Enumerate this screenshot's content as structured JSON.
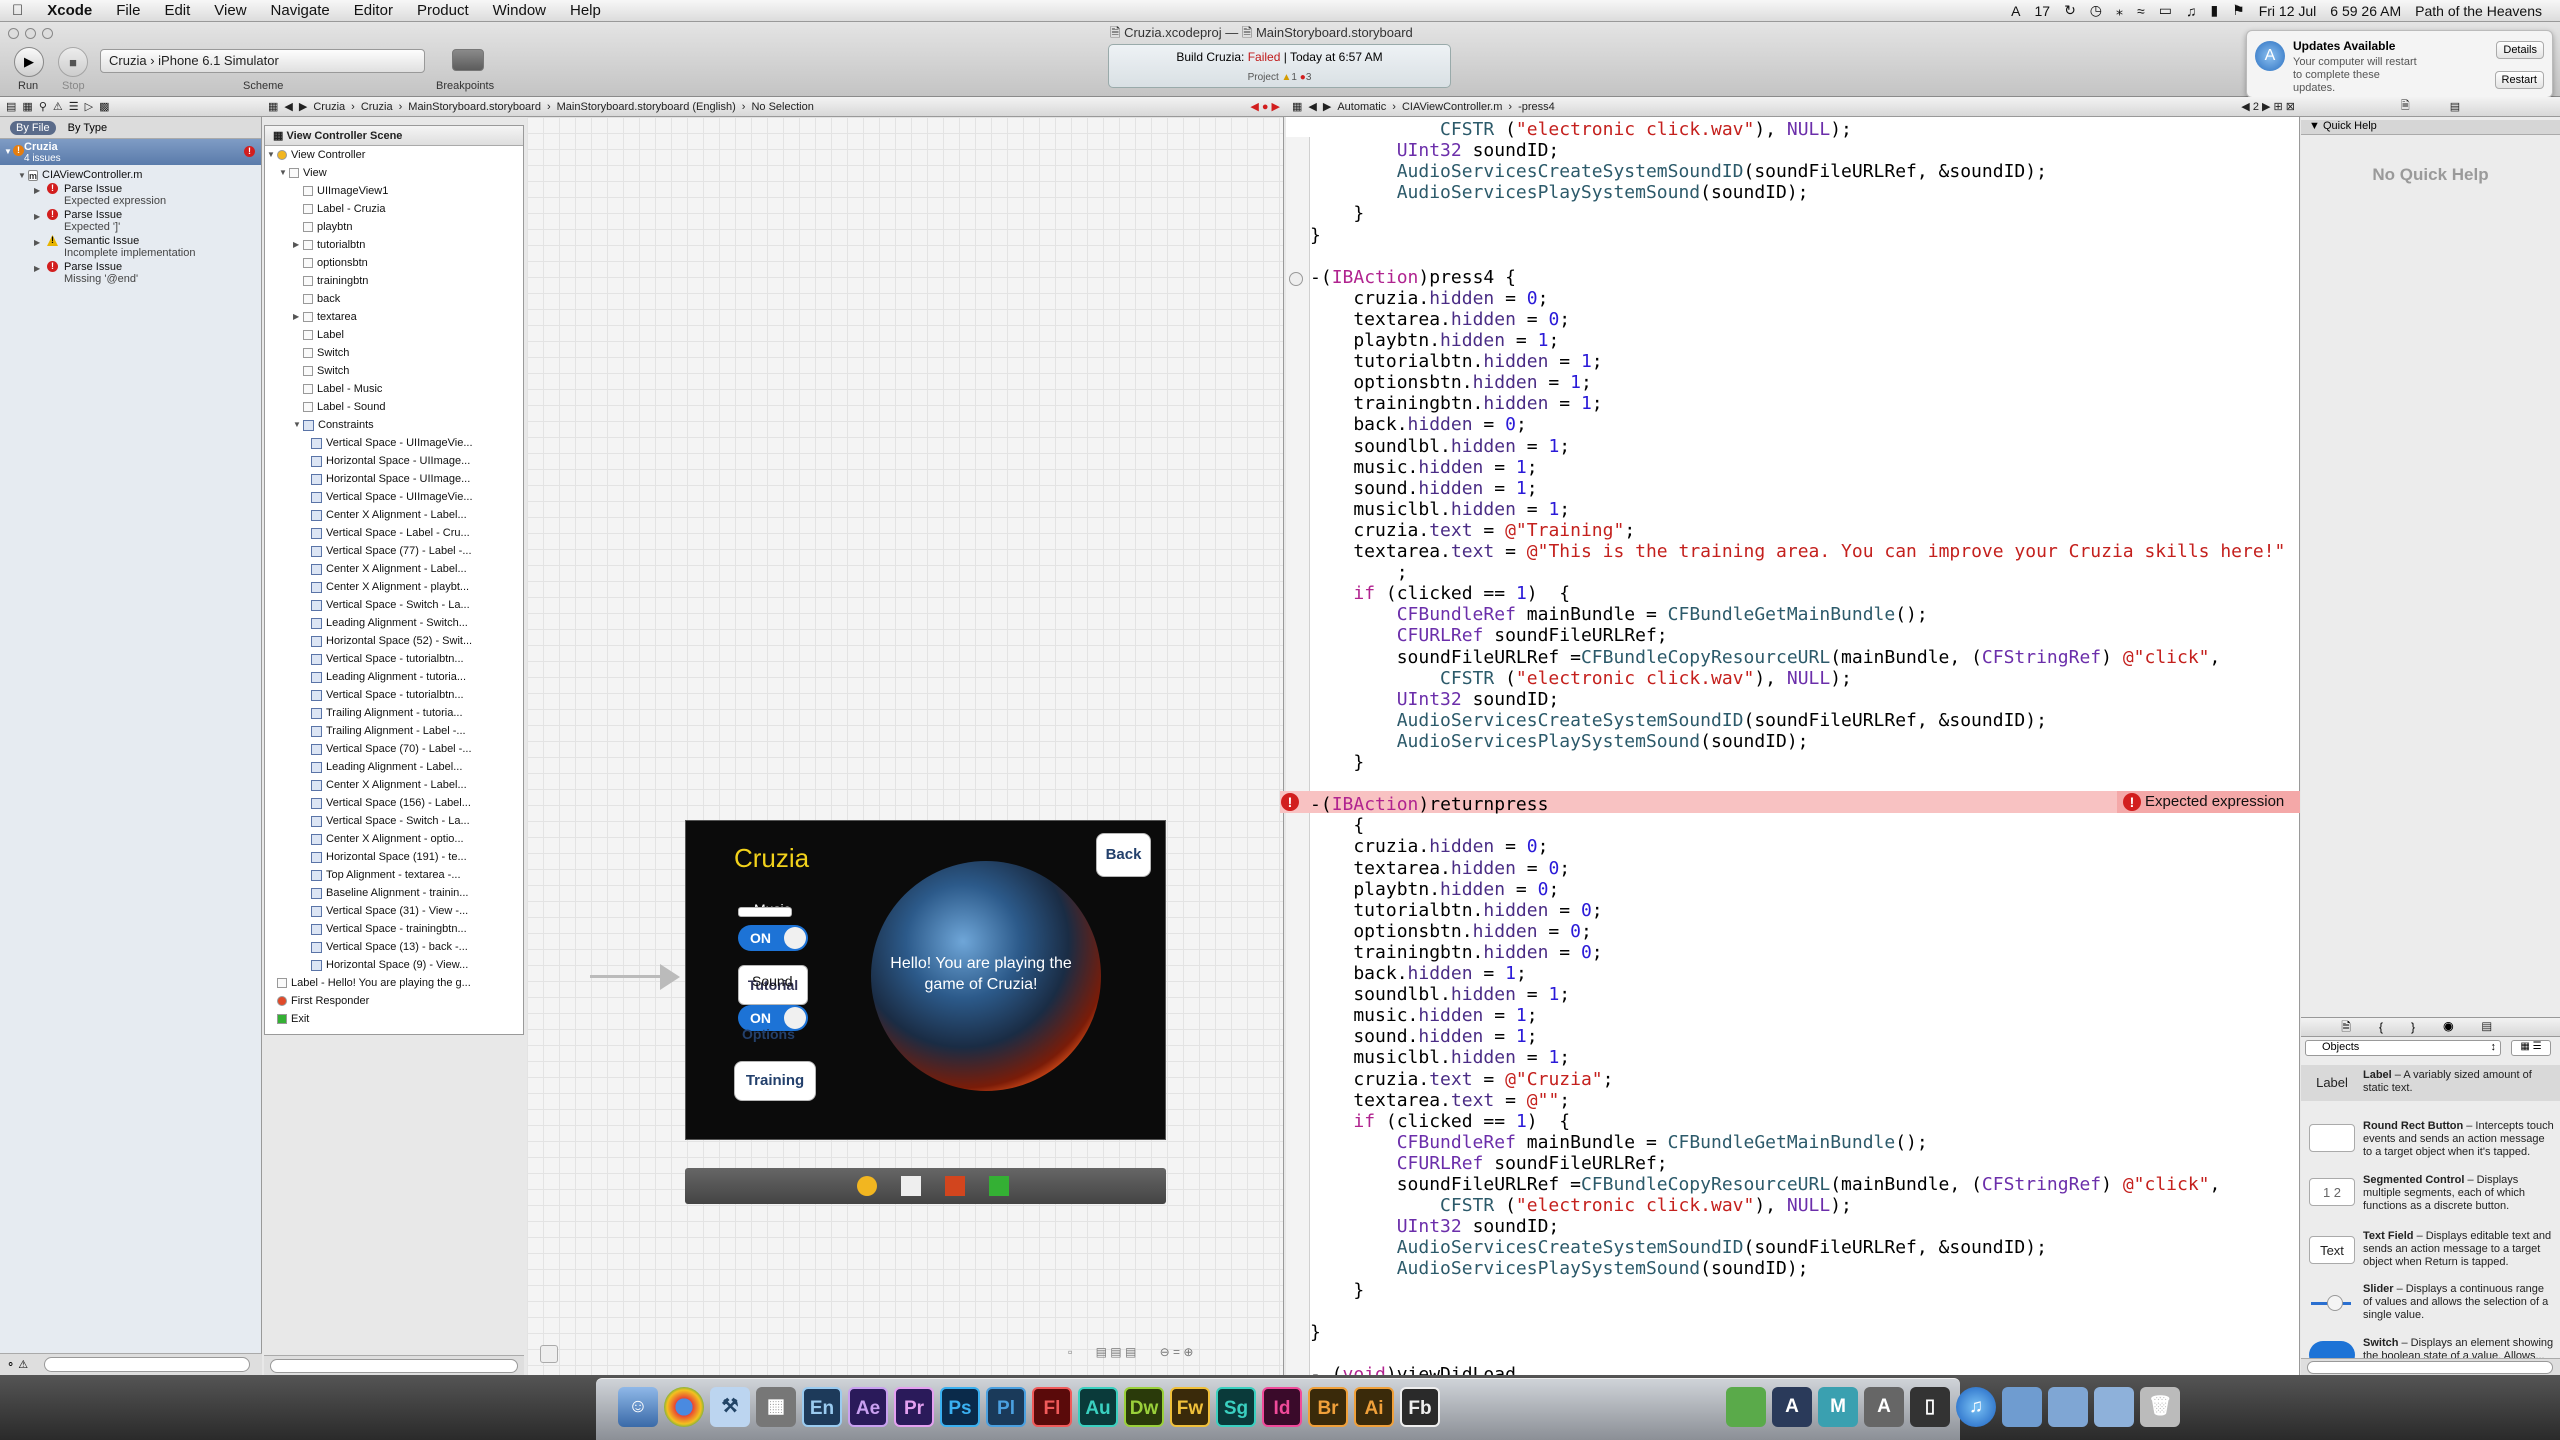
{
  "menubar": {
    "apple": "",
    "app_name": "Xcode",
    "items": [
      "File",
      "Edit",
      "View",
      "Navigate",
      "Editor",
      "Product",
      "Window",
      "Help"
    ],
    "status": [
      "17",
      "Fri 12 Jul",
      "6 59 26 AM",
      "Path of the Heavens"
    ]
  },
  "toolbar": {
    "run_label": "Run",
    "stop_label": "Stop",
    "scheme_project": "Cruzia",
    "scheme_target": "iPhone 6.1 Simulator",
    "scheme_label": "Scheme",
    "breakpoints_label": "Breakpoints",
    "title_file1": "Cruzia.xcodeproj",
    "title_sep": "—",
    "title_file2": "MainStoryboard.storyboard",
    "activity_build": "Build Cruzia:",
    "activity_status": "Failed",
    "activity_time": "Today at 6:57 AM",
    "activity_project": "Project",
    "activity_warn": "1",
    "activity_err": "3"
  },
  "notification": {
    "title": "Updates Available",
    "body": "Your computer will restart to complete these updates.",
    "details": "Details",
    "restart": "Restart"
  },
  "jumpbar_left": [
    "Cruzia",
    "Cruzia",
    "MainStoryboard.storyboard",
    "MainStoryboard.storyboard (English)",
    "No Selection"
  ],
  "jumpbar_right": [
    "Automatic",
    "CIAViewController.m",
    "-press4"
  ],
  "jumpbar_right_count": "2",
  "navigator": {
    "by_file": "By File",
    "by_type": "By Type",
    "project": "Cruzia",
    "project_sub": "4 issues",
    "file": "CIAViewController.m",
    "issues": [
      {
        "title": "Parse Issue",
        "detail": "Expected expression",
        "kind": "error"
      },
      {
        "title": "Parse Issue",
        "detail": "Expected ']'",
        "kind": "error"
      },
      {
        "title": "Semantic Issue",
        "detail": "Incomplete implementation",
        "kind": "warning"
      },
      {
        "title": "Parse Issue",
        "detail": "Missing '@end'",
        "kind": "error"
      }
    ]
  },
  "outline": {
    "header": "View Controller Scene",
    "rows": [
      "View Controller",
      "View",
      "UIImageView1",
      "Label - Cruzia",
      "playbtn",
      "tutorialbtn",
      "optionsbtn",
      "trainingbtn",
      "back",
      "textarea",
      "Label",
      "Switch",
      "Switch",
      "Label - Music",
      "Label - Sound",
      "Constraints",
      "Vertical Space - UIImageVie...",
      "Horizontal Space - UIImage...",
      "Horizontal Space - UIImage...",
      "Vertical Space - UIImageVie...",
      "Center X Alignment - Label...",
      "Vertical Space - Label - Cru...",
      "Vertical Space (77) - Label -...",
      "Center X Alignment - Label...",
      "Center X Alignment - playbt...",
      "Vertical Space - Switch - La...",
      "Leading Alignment - Switch...",
      "Horizontal Space (52) - Swit...",
      "Vertical Space - tutorialbtn...",
      "Leading Alignment - tutoria...",
      "Vertical Space - tutorialbtn...",
      "Trailing Alignment - tutoria...",
      "Trailing Alignment - Label -...",
      "Vertical Space (70) - Label -...",
      "Leading Alignment - Label...",
      "Center X Alignment - Label...",
      "Vertical Space (156) - Label...",
      "Vertical Space - Switch - La...",
      "Center X Alignment - optio...",
      "Horizontal Space (191) - te...",
      "Top Alignment - textarea -...",
      "Baseline Alignment - trainin...",
      "Vertical Space (31) - View -...",
      "Vertical Space - trainingbtn...",
      "Vertical Space (13) - back -...",
      "Horizontal Space (9) - View...",
      "Label - Hello! You are playing the g...",
      "First Responder",
      "Exit"
    ]
  },
  "iphone": {
    "title": "Cruzia",
    "back": "Back",
    "music_label": "Music",
    "sound_label": "Sound",
    "tutorial": "Tutorial",
    "toggle_on": "ON",
    "options": "Options",
    "training": "Training",
    "message": "Hello! You are playing the game of Cruzia!"
  },
  "code": {
    "error_message": "Expected expression",
    "lines": [
      {
        "t": "            CFSTR (\"electronic click.wav\"), NULL);"
      },
      {
        "t": "        UInt32 soundID;"
      },
      {
        "t": "        AudioServicesCreateSystemSoundID(soundFileURLRef, &soundID);"
      },
      {
        "t": "        AudioServicesPlaySystemSound(soundID);"
      },
      {
        "t": "    }"
      },
      {
        "t": "}"
      },
      {
        "t": ""
      },
      {
        "t": "-(IBAction)press4 {"
      },
      {
        "t": "    cruzia.hidden = 0;"
      },
      {
        "t": "    textarea.hidden = 0;"
      },
      {
        "t": "    playbtn.hidden = 1;"
      },
      {
        "t": "    tutorialbtn.hidden = 1;"
      },
      {
        "t": "    optionsbtn.hidden = 1;"
      },
      {
        "t": "    trainingbtn.hidden = 1;"
      },
      {
        "t": "    back.hidden = 0;"
      },
      {
        "t": "    soundlbl.hidden = 1;"
      },
      {
        "t": "    music.hidden = 1;"
      },
      {
        "t": "    sound.hidden = 1;"
      },
      {
        "t": "    musiclbl.hidden = 1;"
      },
      {
        "t": "    cruzia.text = @\"Training\";"
      },
      {
        "t": "    textarea.text = @\"This is the training area. You can improve your Cruzia skills here!\""
      },
      {
        "t": "        ;"
      },
      {
        "t": "    if (clicked == 1)  {"
      },
      {
        "t": "        CFBundleRef mainBundle = CFBundleGetMainBundle();"
      },
      {
        "t": "        CFURLRef soundFileURLRef;"
      },
      {
        "t": "        soundFileURLRef =CFBundleCopyResourceURL(mainBundle, (CFStringRef) @\"click\","
      },
      {
        "t": "            CFSTR (\"electronic click.wav\"), NULL);"
      },
      {
        "t": "        UInt32 soundID;"
      },
      {
        "t": "        AudioServicesCreateSystemSoundID(soundFileURLRef, &soundID);"
      },
      {
        "t": "        AudioServicesPlaySystemSound(soundID);"
      },
      {
        "t": "    }"
      },
      {
        "t": ""
      },
      {
        "t": "-(IBAction)returnpress"
      },
      {
        "t": "    {"
      },
      {
        "t": "    cruzia.hidden = 0;"
      },
      {
        "t": "    textarea.hidden = 0;"
      },
      {
        "t": "    playbtn.hidden = 0;"
      },
      {
        "t": "    tutorialbtn.hidden = 0;"
      },
      {
        "t": "    optionsbtn.hidden = 0;"
      },
      {
        "t": "    trainingbtn.hidden = 0;"
      },
      {
        "t": "    back.hidden = 1;"
      },
      {
        "t": "    soundlbl.hidden = 1;"
      },
      {
        "t": "    music.hidden = 1;"
      },
      {
        "t": "    sound.hidden = 1;"
      },
      {
        "t": "    musiclbl.hidden = 1;"
      },
      {
        "t": "    cruzia.text = @\"Cruzia\";"
      },
      {
        "t": "    textarea.text = @\"\";"
      },
      {
        "t": "    if (clicked == 1)  {"
      },
      {
        "t": "        CFBundleRef mainBundle = CFBundleGetMainBundle();"
      },
      {
        "t": "        CFURLRef soundFileURLRef;"
      },
      {
        "t": "        soundFileURLRef =CFBundleCopyResourceURL(mainBundle, (CFStringRef) @\"click\","
      },
      {
        "t": "            CFSTR (\"electronic click.wav\"), NULL);"
      },
      {
        "t": "        UInt32 soundID;"
      },
      {
        "t": "        AudioServicesCreateSystemSoundID(soundFileURLRef, &soundID);"
      },
      {
        "t": "        AudioServicesPlaySystemSound(soundID);"
      },
      {
        "t": "    }"
      },
      {
        "t": ""
      },
      {
        "t": "}"
      },
      {
        "t": ""
      },
      {
        "t": "- (void)viewDidLoad"
      }
    ]
  },
  "utilities": {
    "quick_help_title": "Quick Help",
    "no_quick_help": "No Quick Help",
    "objects_select": "Objects",
    "library": [
      {
        "icon": "Label",
        "name": "Label",
        "desc": " – A variably sized amount of static text."
      },
      {
        "icon": "",
        "name": "Round Rect Button",
        "desc": " – Intercepts touch events and sends an action message to a target object when it's tapped."
      },
      {
        "icon": "1 2",
        "name": "Segmented Control",
        "desc": " – Displays multiple segments, each of which functions as a discrete button."
      },
      {
        "icon": "Text",
        "name": "Text Field",
        "desc": " – Displays editable text and sends an action message to a target object when Return is tapped."
      },
      {
        "icon": "",
        "name": "Slider",
        "desc": " – Displays a continuous range of values and allows the selection of a single value."
      },
      {
        "icon": "",
        "name": "Switch",
        "desc": " – Displays an element showing the boolean state of a value. Allows..."
      }
    ]
  },
  "dock": [
    "En",
    "Ae",
    "Pr",
    "Ps",
    "Pl",
    "Fl",
    "Au",
    "Dw",
    "Fw",
    "Sg",
    "Id",
    "Br",
    "Ai",
    "Fb"
  ],
  "colors": {
    "error_red": "#d21e1e",
    "error_line": "#f8c2c2",
    "ios_blue": "#1d73d6",
    "keyword": "#b0238f",
    "string": "#c4201d"
  }
}
